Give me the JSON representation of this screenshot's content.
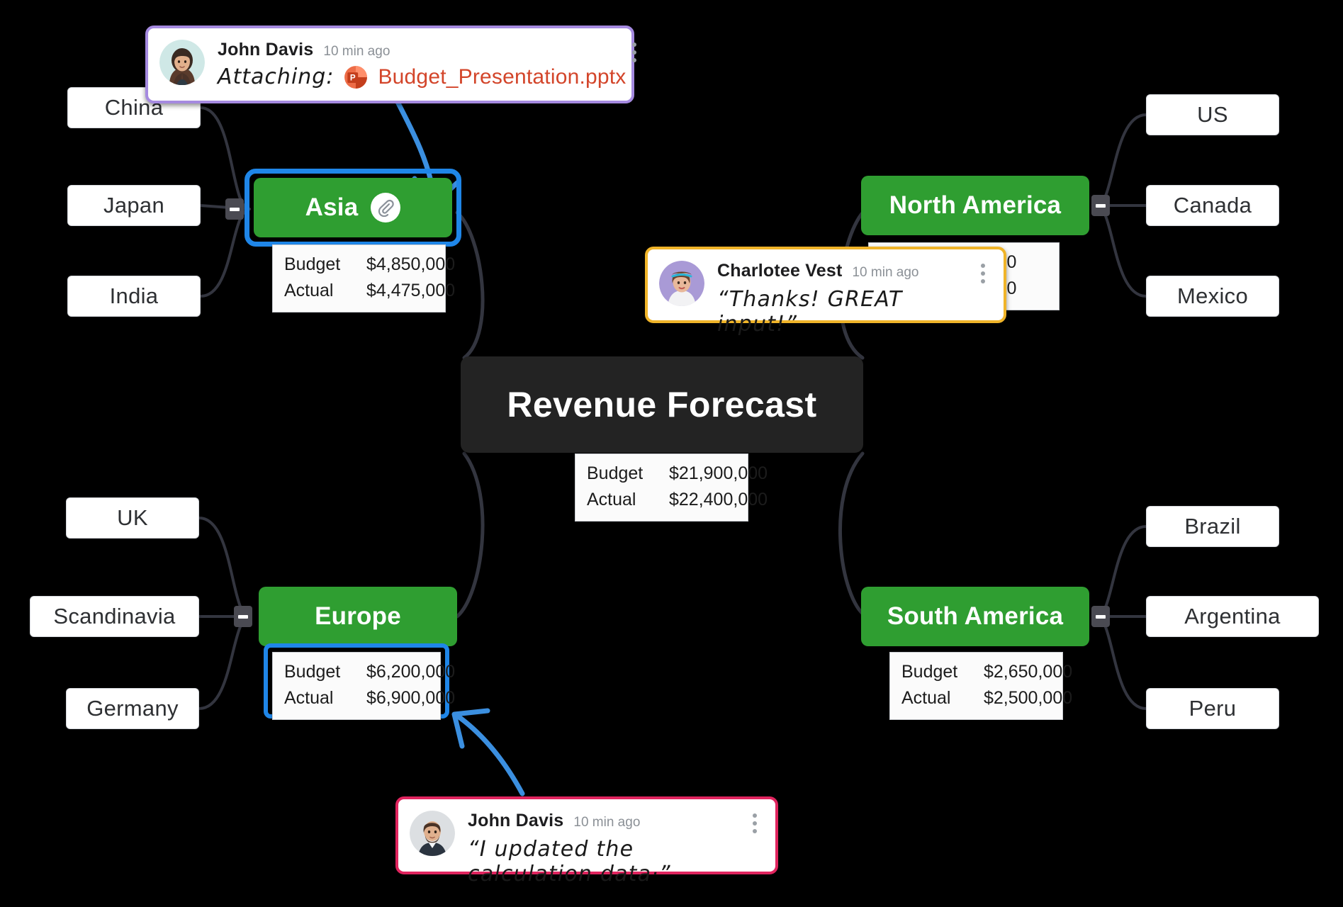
{
  "root": {
    "label": "Revenue Forecast",
    "table": {
      "rows": [
        {
          "label": "Budget",
          "value": "$21,900,000"
        },
        {
          "label": "Actual",
          "value": "$22,400,000"
        }
      ]
    }
  },
  "branches": {
    "asia": {
      "label": "Asia",
      "attachment_icon": "paperclip-icon",
      "selected": true,
      "table": {
        "rows": [
          {
            "label": "Budget",
            "value": "$4,850,000"
          },
          {
            "label": "Actual",
            "value": "$4,475,000"
          }
        ]
      },
      "children": [
        {
          "label": "China"
        },
        {
          "label": "Japan"
        },
        {
          "label": "India"
        }
      ]
    },
    "europe": {
      "label": "Europe",
      "table_selected": true,
      "table": {
        "rows": [
          {
            "label": "Budget",
            "value": "$6,200,000"
          },
          {
            "label": "Actual",
            "value": "$6,900,000"
          }
        ]
      },
      "children": [
        {
          "label": "UK"
        },
        {
          "label": "Scandinavia"
        },
        {
          "label": "Germany"
        }
      ]
    },
    "north_america": {
      "label": "North America",
      "table": {
        "rows": [
          {
            "label": "",
            "value": "00,000"
          },
          {
            "label": "",
            "value": "25,000"
          }
        ]
      },
      "children": [
        {
          "label": "US"
        },
        {
          "label": "Canada"
        },
        {
          "label": "Mexico"
        }
      ]
    },
    "south_america": {
      "label": "South America",
      "table": {
        "rows": [
          {
            "label": "Budget",
            "value": "$2,650,000"
          },
          {
            "label": "Actual",
            "value": "$2,500,000"
          }
        ]
      },
      "children": [
        {
          "label": "Brazil"
        },
        {
          "label": "Argentina"
        },
        {
          "label": "Peru"
        }
      ]
    }
  },
  "comments": [
    {
      "id": "attach-card",
      "author": "John Davis",
      "time": "10 min ago",
      "attach_label": "Attaching:",
      "file_name": "Budget_Presentation.pptx",
      "file_icon": "powerpoint-icon",
      "menu_icon": "kebab-menu-icon",
      "border_color": "#a58ae0"
    },
    {
      "id": "praise-card",
      "author": "Charlotee Vest",
      "time": "10 min ago",
      "text": "“Thanks!  GREAT input!”",
      "menu_icon": "kebab-menu-icon",
      "border_color": "#f0b429"
    },
    {
      "id": "update-card",
      "author": "John Davis",
      "time": "10 min ago",
      "text": "“I updated the calculation data·”",
      "menu_icon": "kebab-menu-icon",
      "border_color": "#e0245e"
    }
  ],
  "colors": {
    "background": "#000000",
    "branch_green": "#2f9e31",
    "root_dark": "#232323",
    "selection_blue": "#1f86e8",
    "arrow_blue": "#3b8fe0",
    "edge_gray": "#33353f",
    "file_red": "#d3452a"
  },
  "toggles": {
    "icon": "collapse-minus-icon",
    "count": 4
  }
}
